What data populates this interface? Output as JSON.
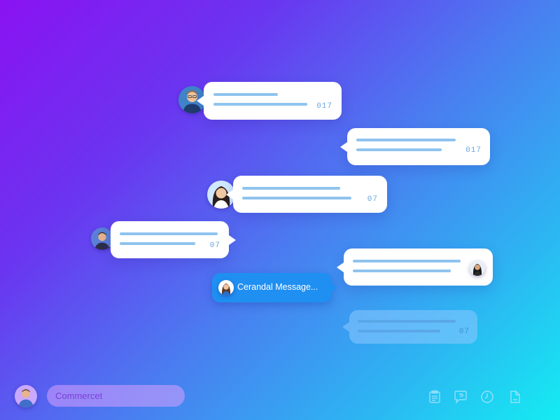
{
  "messages": [
    {
      "id": "m1",
      "time": "017",
      "direction": "incoming"
    },
    {
      "id": "m2",
      "time": "017",
      "direction": "outgoing"
    },
    {
      "id": "m3",
      "time": "07",
      "direction": "incoming"
    },
    {
      "id": "m4",
      "time": "07",
      "direction": "incoming"
    },
    {
      "id": "m5",
      "time": "",
      "direction": "outgoing"
    },
    {
      "id": "m6",
      "time": "07",
      "direction": "outgoing"
    }
  ],
  "active_message": {
    "label": "Cerandal Message..."
  },
  "composer": {
    "placeholder": "Commercet"
  },
  "toolbar": {
    "icons": [
      "document-icon",
      "chat-icon",
      "clock-icon",
      "file-icon"
    ]
  },
  "colors": {
    "gradient_start": "#8a12f2",
    "gradient_end": "#14ecf2",
    "bubble": "#ffffff",
    "line": "#8fc3ee",
    "accent": "#1f8ff2"
  }
}
